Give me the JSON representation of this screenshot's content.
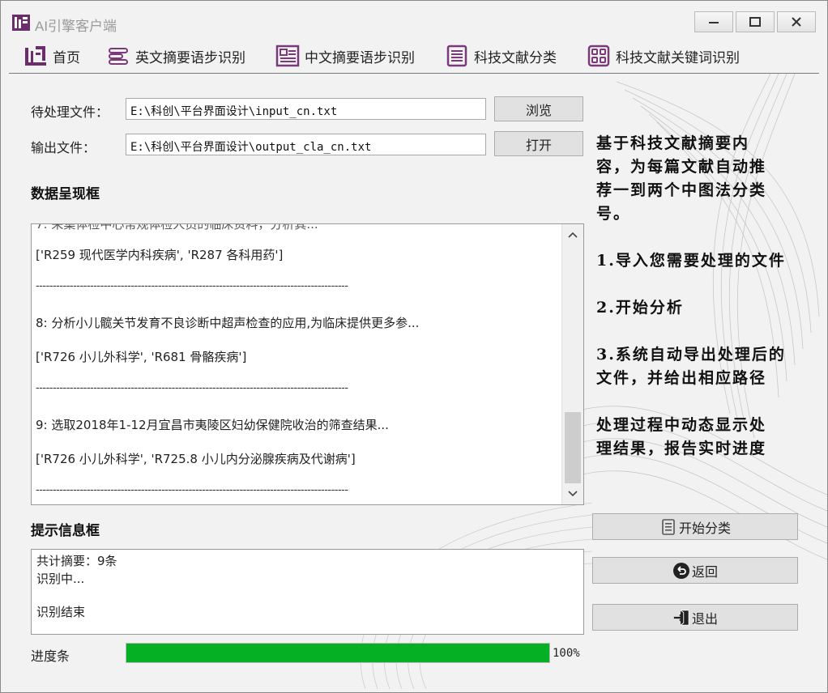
{
  "window": {
    "title": "AI引擎客户端"
  },
  "toolbar": {
    "items": [
      {
        "label": "首页",
        "icon": "home-logo-icon"
      },
      {
        "label": "英文摘要语步识别",
        "icon": "lines-icon"
      },
      {
        "label": "中文摘要语步识别",
        "icon": "document-icon"
      },
      {
        "label": "科技文献分类",
        "icon": "list-icon"
      },
      {
        "label": "科技文献关键词识别",
        "icon": "grid-icon"
      }
    ]
  },
  "form": {
    "input_label": "待处理文件：",
    "input_value": "E:\\科创\\平台界面设计\\input_cn.txt",
    "browse_label": "浏览",
    "output_label": "输出文件：",
    "output_value": "E:\\科创\\平台界面设计\\output_cla_cn.txt",
    "open_label": "打开"
  },
  "data_panel": {
    "title": "数据呈现框",
    "lines": [
      "['R259 现代医学内科疾病', 'R287 各科用药']",
      "--------------------------------------------------------------------------------------------",
      "8: 分析小儿髋关节发育不良诊断中超声检查的应用,为临床提供更多参...",
      "['R726 小儿外科学', 'R681 骨骼疾病']",
      "--------------------------------------------------------------------------------------------",
      "9: 选取2018年1-12月宜昌市夷陵区妇幼保健院收治的筛查结果...",
      "['R726 小儿外科学', 'R725.8 小儿内分泌腺疾病及代谢病']",
      "--------------------------------------------------------------------------------------------"
    ]
  },
  "info_panel": {
    "title": "提示信息框",
    "lines": [
      "共计摘要：9条",
      "识别中...",
      "识别结束"
    ]
  },
  "description": {
    "lines": [
      "基于科技文献摘要内",
      "容，为每篇文献自动推",
      "荐一到两个中图法分类",
      "号。",
      "1.导入您需要处理的文件",
      "2.开始分析",
      "3.系统自动导出处理后的",
      "文件，并给出相应路径",
      "处理过程中动态显示处",
      "理结果，报告实时进度"
    ]
  },
  "actions": {
    "start_label": "开始分类",
    "back_label": "返回",
    "exit_label": "退出"
  },
  "progress": {
    "label": "进度条",
    "value": 1.0,
    "text": "100%",
    "color": "#06b025"
  },
  "colors": {
    "window_bg": "#f2f2f2",
    "accent_purple": "#6b2d6b"
  }
}
